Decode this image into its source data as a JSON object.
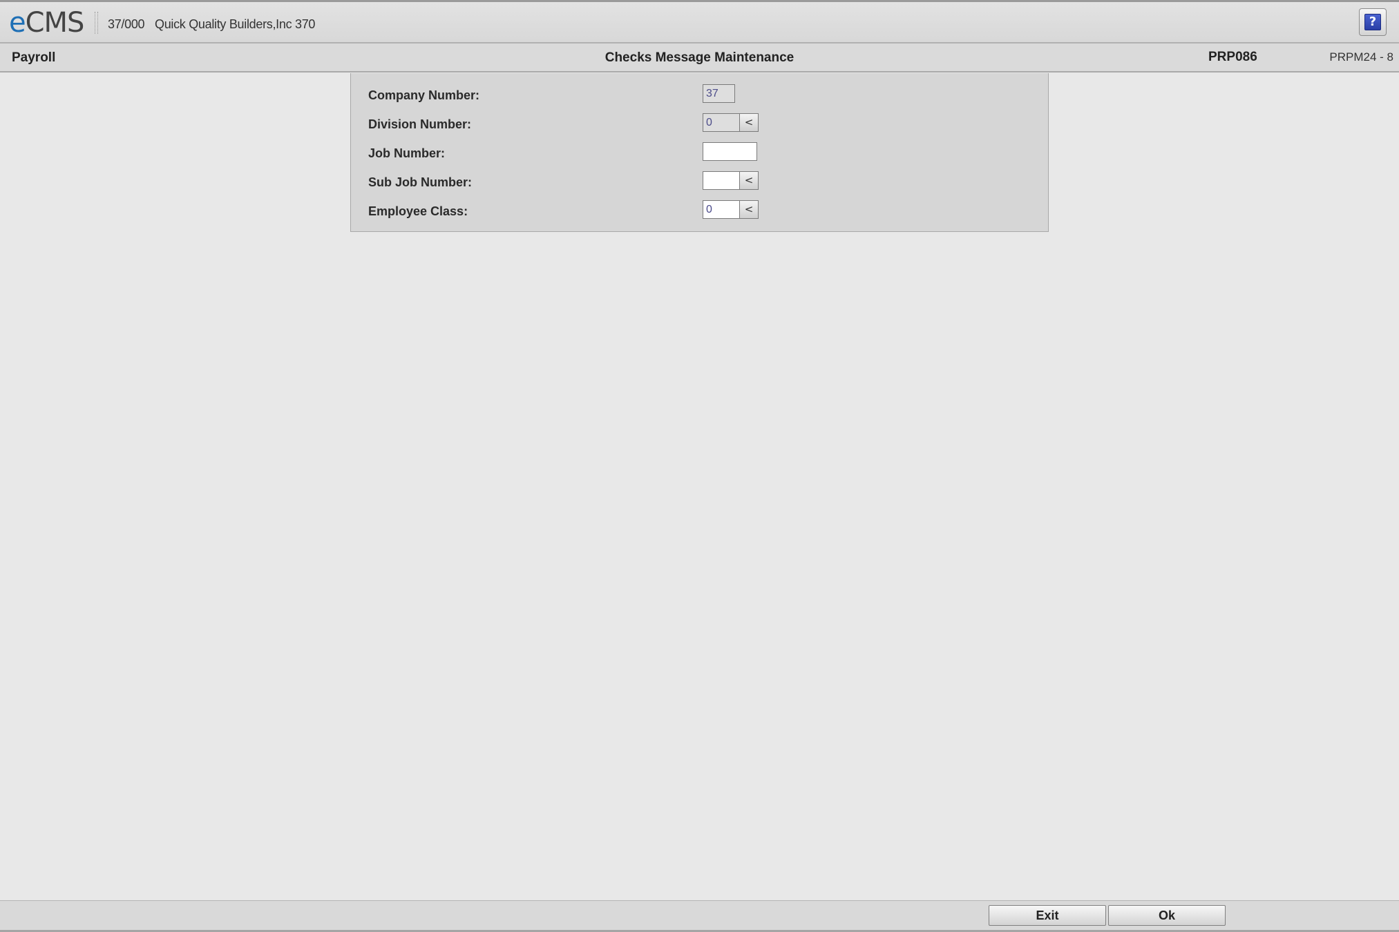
{
  "header": {
    "logo_e": "e",
    "logo_cms": "CMS",
    "company_code": "37/000",
    "company_name": "Quick Quality Builders,Inc 370",
    "help_label": "?"
  },
  "title_bar": {
    "module": "Payroll",
    "page_title": "Checks Message Maintenance",
    "program_id": "PRP086",
    "screen_id": "PRPM24 - 8"
  },
  "form": {
    "company_number": {
      "label": "Company Number:",
      "value": "37"
    },
    "division_number": {
      "label": "Division Number:",
      "value": "0",
      "lookup": "<"
    },
    "job_number": {
      "label": "Job Number:",
      "value": ""
    },
    "sub_job_number": {
      "label": "Sub Job Number:",
      "value": "",
      "lookup": "<"
    },
    "employee_class": {
      "label": "Employee Class:",
      "value": "0",
      "lookup": "<"
    }
  },
  "footer": {
    "exit_label": "Exit",
    "ok_label": "Ok"
  }
}
